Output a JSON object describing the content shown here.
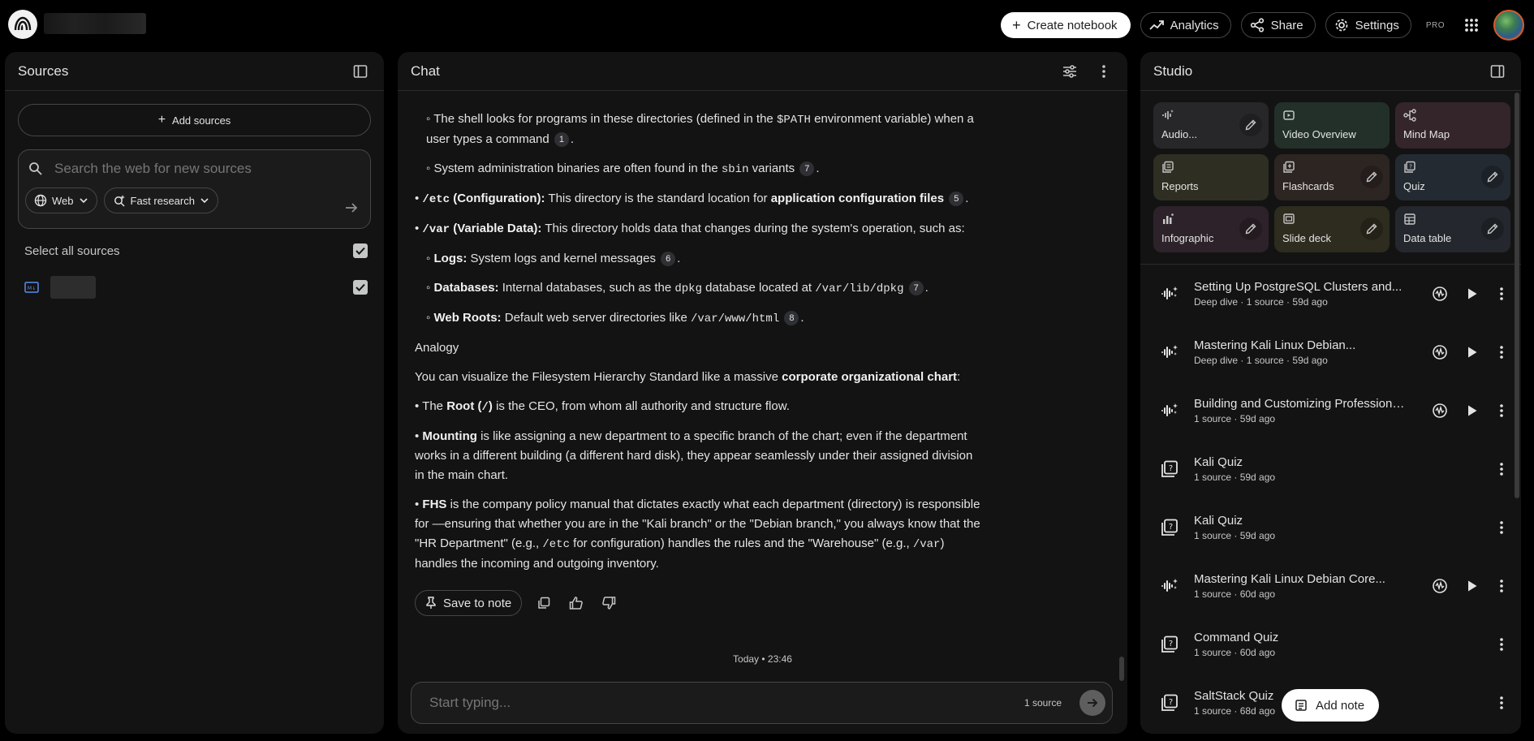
{
  "topbar": {
    "create_label": "Create notebook",
    "analytics_label": "Analytics",
    "share_label": "Share",
    "settings_label": "Settings",
    "pro_label": "PRO"
  },
  "sources": {
    "title": "Sources",
    "add_label": "Add sources",
    "search_placeholder": "Search the web for new sources",
    "web_chip": "Web",
    "research_chip": "Fast research",
    "select_all": "Select all sources"
  },
  "chat": {
    "title": "Chat",
    "timestamp": "Today • 23:46",
    "input_placeholder": "Start typing...",
    "source_count": "1 source",
    "save_note": "Save to note",
    "lines": {
      "l1a": "The shell looks for programs in these directories (defined in the",
      "l1code": "$PATH",
      "l1b": "environment variable) when a user types a command",
      "c1": "1",
      "l2a": "System administration binaries are often found in the",
      "l2code": "sbin",
      "l2b": "variants",
      "c7a": "7",
      "etc_code": "/etc",
      "etc_head": "(Configuration):",
      "etc_text": "This directory is the standard location for",
      "etc_bold": "application configuration files",
      "c5": "5",
      "var_code": "/var",
      "var_head": "(Variable Data):",
      "var_text": "This directory holds data that changes during the system's operation, such as:",
      "logs_head": "Logs:",
      "logs_text": "System logs and kernel messages",
      "c6": "6",
      "db_head": "Databases:",
      "db_text1": "Internal databases, such as the",
      "db_code1": "dpkg",
      "db_text2": "database located at",
      "db_code2": "/var/lib/dpkg",
      "c7b": "7",
      "web_head": "Web Roots:",
      "web_text": "Default web server directories like",
      "web_code": "/var/www/html",
      "c8": "8",
      "analogy": "Analogy",
      "viz_text": "You can visualize the Filesystem Hierarchy Standard like a massive",
      "viz_bold": "corporate organizational chart",
      "root_a": "The",
      "root_bold": "Root (",
      "root_code": "/",
      "root_bold2": ")",
      "root_b": "is the CEO, from whom all authority and structure flow.",
      "mount_bold": "Mounting",
      "mount_text": "is like assigning a new department to a specific branch of the chart; even if the department works in a different building (a different hard disk), they appear seamlessly under their assigned division in the main chart.",
      "fhs_bold": "FHS",
      "fhs_text1": "is the company policy manual that dictates exactly what each department (directory) is responsible for —ensuring that whether you are in the \"Kali branch\" or the \"Debian branch,\" you always know that the \"HR Department\" (e.g.,",
      "fhs_code1": "/etc",
      "fhs_text2": "for configuration) handles the rules and the \"Warehouse\" (e.g.,",
      "fhs_code2": "/var",
      "fhs_text3": ") handles the incoming and outgoing inventory."
    }
  },
  "studio": {
    "title": "Studio",
    "tiles": [
      {
        "label": "Audio...",
        "color": "#27272a",
        "icon": "audio-icon"
      },
      {
        "label": "Video Overview",
        "color": "#23302a",
        "icon": "video-icon"
      },
      {
        "label": "Mind Map",
        "color": "#34252b",
        "icon": "mindmap-icon"
      },
      {
        "label": "Reports",
        "color": "#2e2e22",
        "icon": "reports-icon"
      },
      {
        "label": "Flashcards",
        "color": "#2d2522",
        "icon": "flashcards-icon"
      },
      {
        "label": "Quiz",
        "color": "#242a32",
        "icon": "quiz-icon"
      },
      {
        "label": "Infographic",
        "color": "#2d2229",
        "icon": "infographic-icon"
      },
      {
        "label": "Slide deck",
        "color": "#2e2b1f",
        "icon": "slides-icon"
      },
      {
        "label": "Data table",
        "color": "#24272e",
        "icon": "table-icon"
      }
    ],
    "items": [
      {
        "title": "Setting Up PostgreSQL Clusters and...",
        "meta": "Deep dive · 1 source · 59d ago",
        "type": "audio"
      },
      {
        "title": "Mastering Kali Linux Debian...",
        "meta": "Deep dive · 1 source · 59d ago",
        "type": "audio"
      },
      {
        "title": "Building and Customizing Professional...",
        "meta": "1 source · 59d ago",
        "type": "audio"
      },
      {
        "title": "Kali Quiz",
        "meta": "1 source · 59d ago",
        "type": "quiz"
      },
      {
        "title": "Kali Quiz",
        "meta": "1 source · 59d ago",
        "type": "quiz"
      },
      {
        "title": "Mastering Kali Linux Debian Core...",
        "meta": "1 source · 60d ago",
        "type": "audio"
      },
      {
        "title": "Command Quiz",
        "meta": "1 source · 60d ago",
        "type": "quiz"
      },
      {
        "title": "SaltStack Quiz",
        "meta": "1 source · 68d ago",
        "type": "quiz"
      }
    ],
    "add_note": "Add note"
  }
}
